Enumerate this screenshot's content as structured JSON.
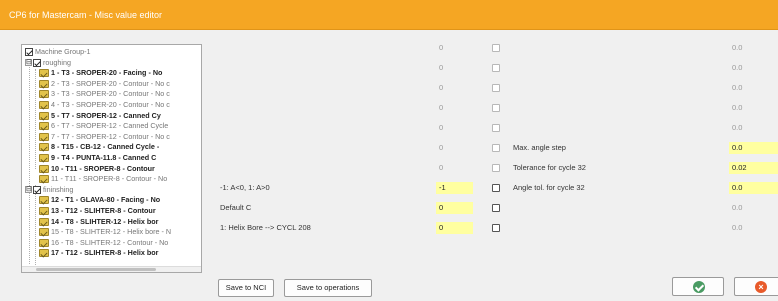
{
  "window": {
    "title": "CP6 for Mastercam - Misc value editor"
  },
  "tree": {
    "root": {
      "label": "Machine Group-1",
      "checked": true
    },
    "groups": [
      {
        "label": "roughing",
        "expander": "⊟",
        "checked": true,
        "items": [
          {
            "label": "1 - T3 - SROPER-20 - Facing - No",
            "bold": true
          },
          {
            "label": "2 - T3 - SROPER-20 - Contour - No c",
            "bold": false
          },
          {
            "label": "3 - T3 - SROPER-20 - Contour - No c",
            "bold": false
          },
          {
            "label": "4 - T3 - SROPER-20 - Contour - No c",
            "bold": false
          },
          {
            "label": "5 - T7 - SROPER-12 - Canned Cy",
            "bold": true
          },
          {
            "label": "6 - T7 - SROPER-12 - Canned Cycle",
            "bold": false
          },
          {
            "label": "7 - T7 - SROPER-12 - Contour - No c",
            "bold": false
          },
          {
            "label": "8 - T15 - CB-12 - Canned Cycle -",
            "bold": true
          },
          {
            "label": "9 - T4 - PUNTA-11.8 - Canned C",
            "bold": true
          },
          {
            "label": "10 - T11 - SROPER-8 - Contour",
            "bold": true
          },
          {
            "label": "11 - T11 - SROPER-8 - Contour - No",
            "bold": false
          }
        ]
      },
      {
        "label": "fininshing",
        "expander": "⊟",
        "checked": true,
        "items": [
          {
            "label": "12 - T1 - GLAVA-80 - Facing - No",
            "bold": true
          },
          {
            "label": "13 - T12 - SLIHTER-8 - Contour",
            "bold": true
          },
          {
            "label": "14 - T8 - SLIHTER-12 - Helix bor",
            "bold": true
          },
          {
            "label": "15 - T8 - SLIHTER-12 - Helix bore - N",
            "bold": false
          },
          {
            "label": "16 - T8 - SLIHTER-12 - Contour - No",
            "bold": false
          },
          {
            "label": "17 - T12 - SLIHTER-8 - Helix bor",
            "bold": true
          }
        ]
      }
    ]
  },
  "rows": [
    {
      "left_label": "",
      "left_value": "0",
      "left_highlight": false,
      "right_label": "",
      "right_value": "0.0",
      "right_highlight": false
    },
    {
      "left_label": "",
      "left_value": "0",
      "left_highlight": false,
      "right_label": "",
      "right_value": "0.0",
      "right_highlight": false
    },
    {
      "left_label": "",
      "left_value": "0",
      "left_highlight": false,
      "right_label": "",
      "right_value": "0.0",
      "right_highlight": false
    },
    {
      "left_label": "",
      "left_value": "0",
      "left_highlight": false,
      "right_label": "",
      "right_value": "0.0",
      "right_highlight": false
    },
    {
      "left_label": "",
      "left_value": "0",
      "left_highlight": false,
      "right_label": "",
      "right_value": "0.0",
      "right_highlight": false
    },
    {
      "left_label": "",
      "left_value": "0",
      "left_highlight": false,
      "right_label": "Max. angle step",
      "right_value": "0.0",
      "right_highlight": true
    },
    {
      "left_label": "",
      "left_value": "0",
      "left_highlight": false,
      "right_label": "Tolerance for cycle 32",
      "right_value": "0.02",
      "right_highlight": true
    },
    {
      "left_label": "-1: A<0, 1: A>0",
      "left_value": "-1",
      "left_highlight": true,
      "right_label": "Angle tol. for cycle 32",
      "right_value": "0.0",
      "right_highlight": true
    },
    {
      "left_label": "Default C",
      "left_value": "0",
      "left_highlight": true,
      "right_label": "",
      "right_value": "0.0",
      "right_highlight": false
    },
    {
      "left_label": "1: Helix Bore --> CYCL 208",
      "left_value": "0",
      "left_highlight": true,
      "right_label": "",
      "right_value": "0.0",
      "right_highlight": false
    }
  ],
  "buttons": {
    "save_nci": "Save to NCI",
    "save_ops": "Save to operations",
    "ok_icon": "check-circle",
    "cancel_icon": "x-circle"
  },
  "colors": {
    "titlebar": "#f5a623",
    "highlight": "#ffffa0",
    "ok": "#4a9b63",
    "cancel": "#e85a2a"
  }
}
